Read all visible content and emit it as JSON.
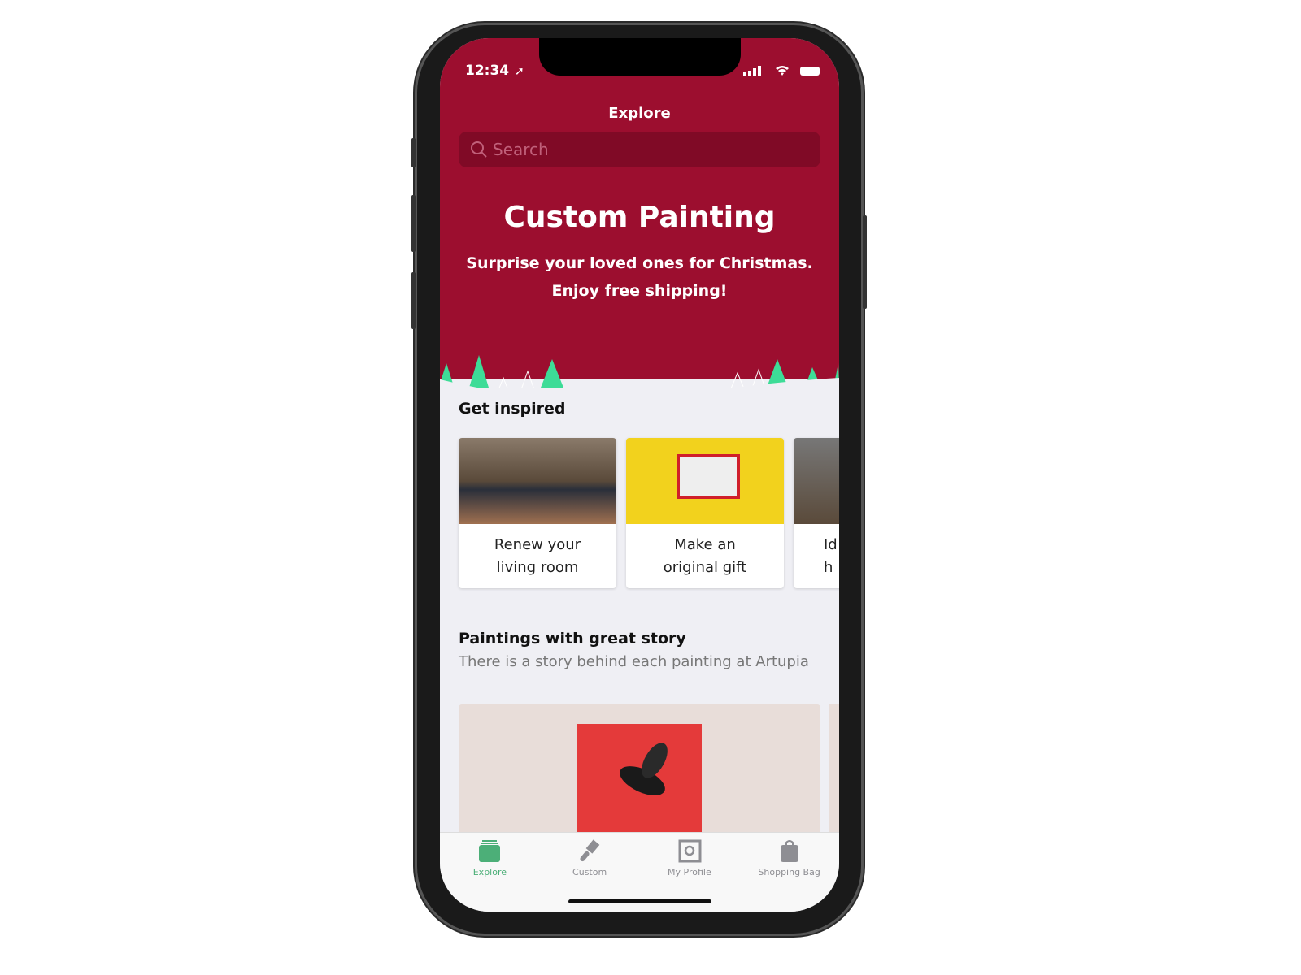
{
  "status": {
    "time": "12:34"
  },
  "header": {
    "title": "Explore",
    "search_placeholder": "Search"
  },
  "banner": {
    "title": "Custom Painting",
    "line1": "Surprise your loved ones for Christmas.",
    "line2": "Enjoy free shipping!"
  },
  "inspired": {
    "title": "Get inspired",
    "cards": [
      {
        "line1": "Renew your",
        "line2": "living room"
      },
      {
        "line1": "Make an",
        "line2": "original gift"
      },
      {
        "line1": "Id",
        "line2": "h"
      }
    ]
  },
  "stories": {
    "title": "Paintings with great story",
    "subtitle": "There is a story behind each painting at Artupia"
  },
  "tabs": [
    {
      "label": "Explore",
      "icon": "cards-icon"
    },
    {
      "label": "Custom",
      "icon": "brush-icon"
    },
    {
      "label": "My Profile",
      "icon": "profile-frame-icon"
    },
    {
      "label": "Shopping Bag",
      "icon": "bag-icon"
    }
  ],
  "colors": {
    "brand": "#9c0e2f",
    "active_tab": "#4caf78",
    "tree": "#3ddc97"
  }
}
